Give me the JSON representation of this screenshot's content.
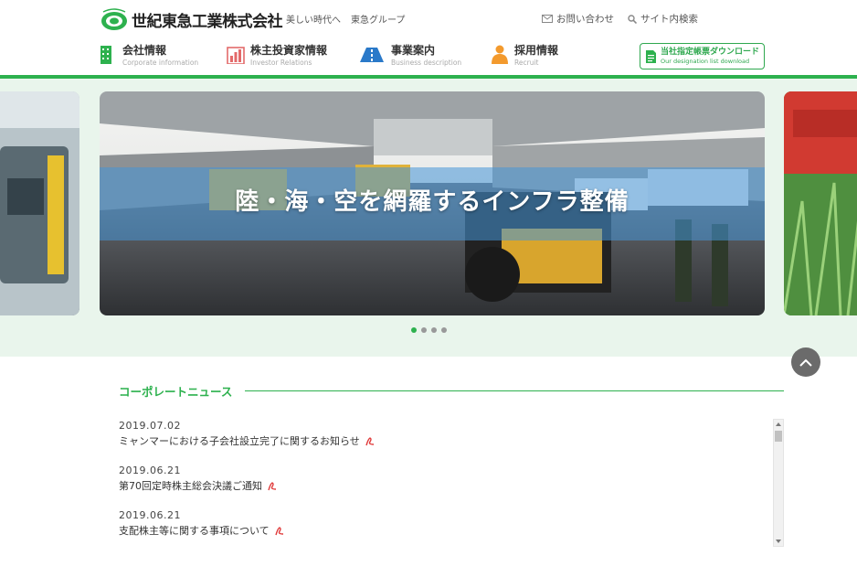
{
  "header": {
    "logo_text": "世紀東急工業株式会社",
    "top_links": [
      "美しい時代へ",
      "東急グループ"
    ],
    "contact_label": "お問い合わせ",
    "search_label": "サイト内検索"
  },
  "gnav": [
    {
      "jp": "会社情報",
      "en": "Corporate information",
      "icon": "building-icon"
    },
    {
      "jp": "株主投資家情報",
      "en": "Investor Relations",
      "icon": "bar-chart-icon"
    },
    {
      "jp": "事業案内",
      "en": "Business description",
      "icon": "road-icon"
    },
    {
      "jp": "採用情報",
      "en": "Recruit",
      "icon": "person-icon"
    }
  ],
  "download": {
    "jp": "当社指定帳票ダウンロード",
    "en": "Our designation list download"
  },
  "slider": {
    "caption": "陸・海・空を網羅するインフラ整備",
    "dot_count": 4,
    "active_index": 0
  },
  "news": {
    "title": "コーポレートニュース",
    "items": [
      {
        "date": "2019.07.02",
        "text": "ミャンマーにおける子会社設立完了に関するお知らせ"
      },
      {
        "date": "2019.06.21",
        "text": "第70回定時株主総会決議ご通知"
      },
      {
        "date": "2019.06.21",
        "text": "支配株主等に関する事項について"
      }
    ]
  },
  "colors": {
    "accent": "#2db14e",
    "slider_bg": "#e9f5ec"
  }
}
